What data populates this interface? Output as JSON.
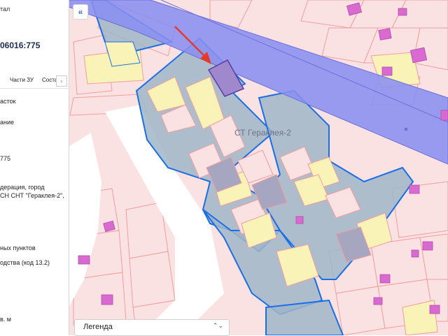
{
  "sidebar": {
    "title_fragment": "тал",
    "cadastral_number": "06016:775",
    "tabs": [
      "Части ЗУ",
      "Соста"
    ],
    "tab_more": "›",
    "lines": [
      "асток",
      "ание",
      "775",
      "дерация, город",
      "СН СНТ \"Гераклея-2\",",
      "ных пунктов",
      "одства (код 13.2)",
      "в. м"
    ]
  },
  "map": {
    "collapse_icon": "«",
    "area_label": "СТ Гераклея-2",
    "legend_label": "Легенда",
    "legend_chevron": "⌃⌄",
    "colors": {
      "background": "#fbe2e2",
      "parcel_outline": "#f19ea0",
      "cadastral_block_fill": "#9fb6c8",
      "cadastral_block_stroke": "#1b6fe6",
      "yellow_parcel": "#faf3b8",
      "road_band": "#8a8ff0",
      "selected_parcel": "#9f88cc",
      "building": "#d96bd0",
      "arrow": "#e53a2a",
      "road_white": "#ffffff"
    }
  }
}
